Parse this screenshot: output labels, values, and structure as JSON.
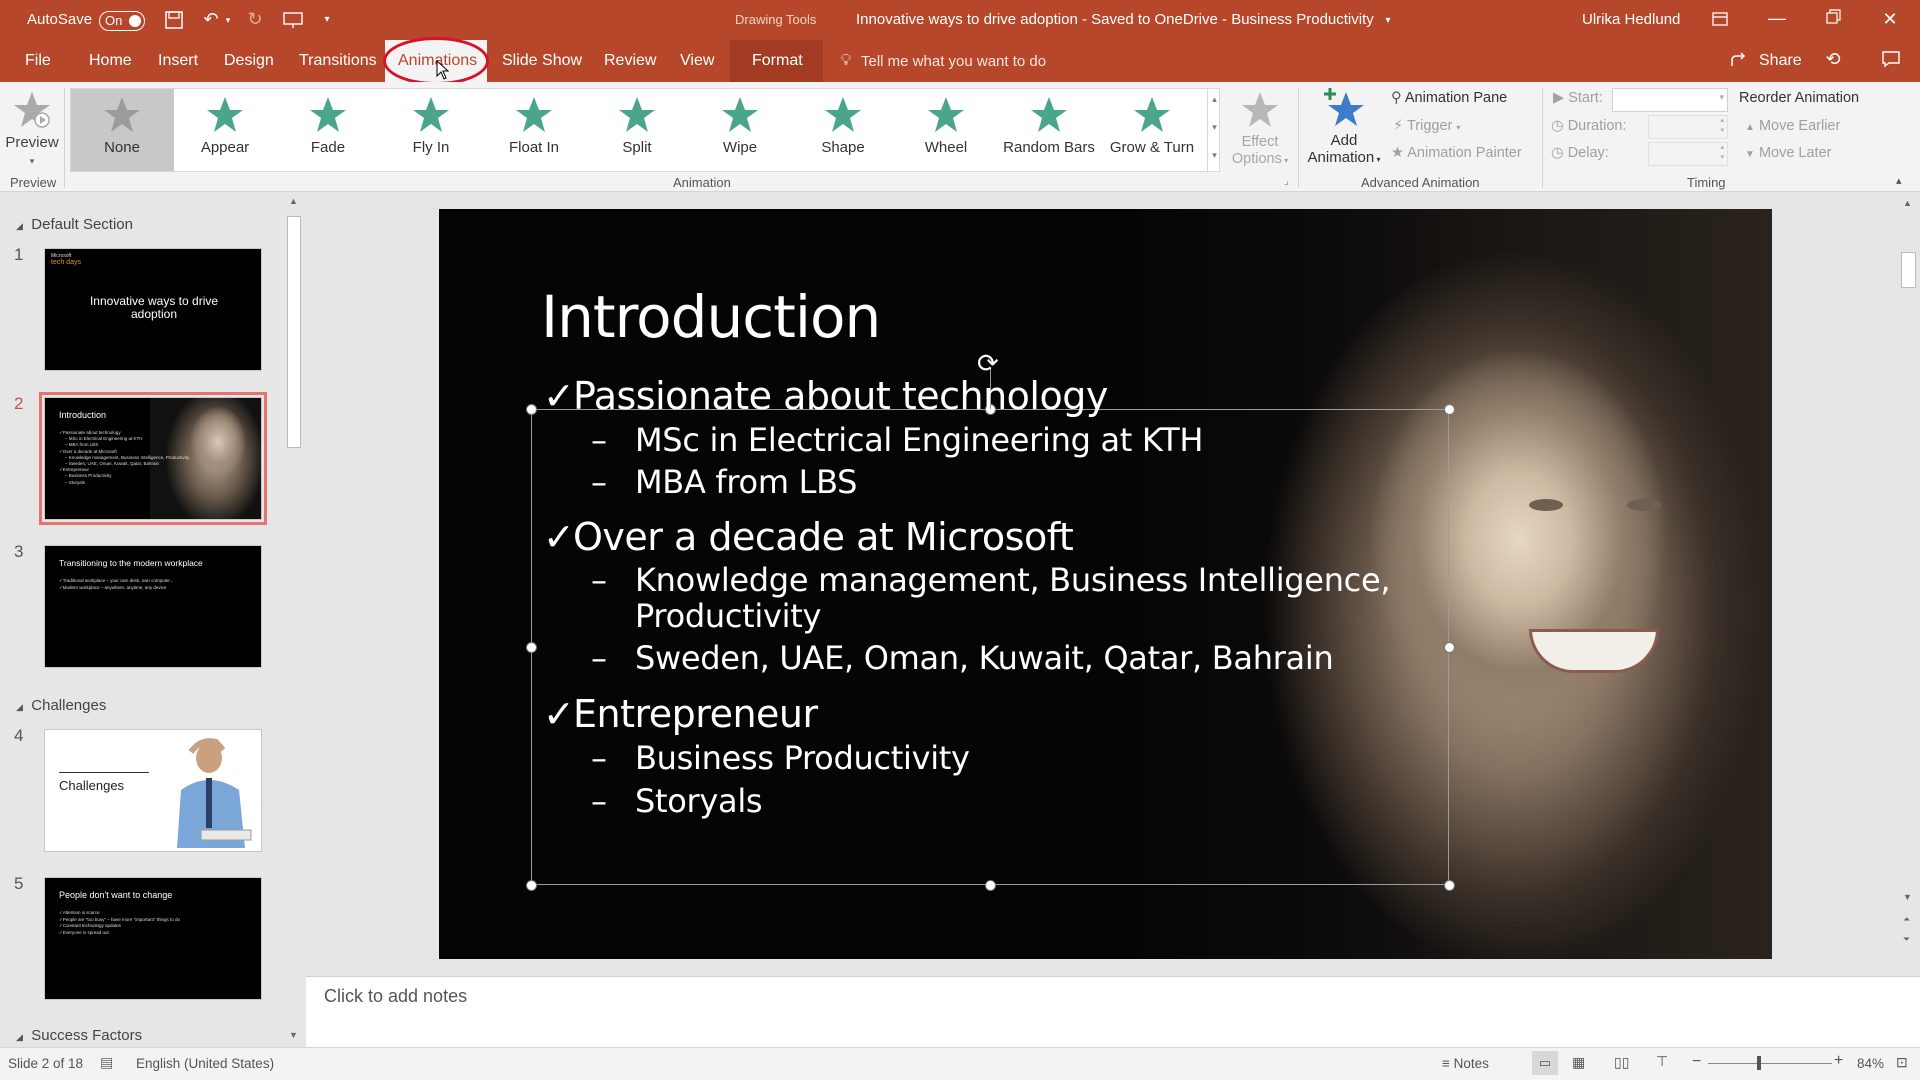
{
  "titlebar": {
    "autosave_label": "AutoSave",
    "autosave_state": "On",
    "context_tab_group": "Drawing Tools",
    "doc_title": "Innovative ways to drive adoption  -  Saved to OneDrive - Business Productivity",
    "user": "Ulrika Hedlund"
  },
  "tabs": {
    "file": "File",
    "home": "Home",
    "insert": "Insert",
    "design": "Design",
    "transitions": "Transitions",
    "animations": "Animations",
    "slideshow": "Slide Show",
    "review": "Review",
    "view": "View",
    "format": "Format",
    "tellme": "Tell me what you want to do",
    "share": "Share"
  },
  "ribbon": {
    "preview_label": "Preview",
    "preview_group": "Preview",
    "animation_group": "Animation",
    "gallery": [
      "None",
      "Appear",
      "Fade",
      "Fly In",
      "Float In",
      "Split",
      "Wipe",
      "Shape",
      "Wheel",
      "Random Bars",
      "Grow & Turn"
    ],
    "effect_options_1": "Effect",
    "effect_options_2": "Options",
    "add_animation_1": "Add",
    "add_animation_2": "Animation",
    "animation_pane": "Animation Pane",
    "trigger": "Trigger",
    "animation_painter": "Animation Painter",
    "advanced_group": "Advanced Animation",
    "start_label": "Start:",
    "duration_label": "Duration:",
    "delay_label": "Delay:",
    "timing_group": "Timing",
    "reorder_title": "Reorder Animation",
    "move_earlier": "Move Earlier",
    "move_later": "Move Later"
  },
  "sections": {
    "default": "Default Section",
    "challenges": "Challenges",
    "success": "Success Factors"
  },
  "thumbnails": [
    {
      "num": "1",
      "brand1": "Microsoft",
      "brand2": "tech days",
      "title": "Innovative ways to drive adoption"
    },
    {
      "num": "2",
      "title": "Introduction",
      "lines": [
        "✓Passionate about technology",
        "– MSc in Electrical Engineering at KTH",
        "– MBA from LBS",
        "✓Over a decade at Microsoft",
        "– Knowledge management, Business Intelligence, Productivity",
        "– Sweden, UAE, Oman, Kuwait, Qatar, Bahrain",
        "✓Entrepreneur",
        "– Business Productivity",
        "– Storyals"
      ]
    },
    {
      "num": "3",
      "title": "Transitioning to the modern workplace",
      "lines": [
        "✓Traditional workplace – your own desk, own computer...",
        "✓Modern workplace – anywhere, anytime, any device"
      ]
    },
    {
      "num": "4",
      "title": "Challenges"
    },
    {
      "num": "5",
      "title": "People don't want to change",
      "lines": [
        "✓Attention is scarce",
        "✓People are \"too busy\" – have more \"important\" things to do",
        "✓Constant technology updates",
        "✓Everyone is spread out"
      ]
    }
  ],
  "slide": {
    "title": "Introduction",
    "bullets": [
      {
        "level": 1,
        "text": "Passionate about technology"
      },
      {
        "level": 2,
        "text": "MSc in Electrical Engineering at KTH"
      },
      {
        "level": 2,
        "text": "MBA from LBS"
      },
      {
        "level": 1,
        "text": "Over a decade at Microsoft"
      },
      {
        "level": 2,
        "text": "Knowledge management, Business Intelligence,"
      },
      {
        "level": 2,
        "text": "Productivity"
      },
      {
        "level": 2,
        "text": "Sweden, UAE, Oman, Kuwait, Qatar, Bahrain"
      },
      {
        "level": 1,
        "text": "Entrepreneur"
      },
      {
        "level": 2,
        "text": "Business Productivity"
      },
      {
        "level": 2,
        "text": "Storyals"
      }
    ]
  },
  "notes_placeholder": "Click to add notes",
  "status": {
    "slide_pos": "Slide 2 of 18",
    "language": "English (United States)",
    "notes": "Notes",
    "zoom": "84%"
  },
  "colors": {
    "accent": "#b7472a",
    "star_green": "#4aa58a",
    "star_gray": "#9b9b9b",
    "star_blue": "#3d7cc9"
  }
}
